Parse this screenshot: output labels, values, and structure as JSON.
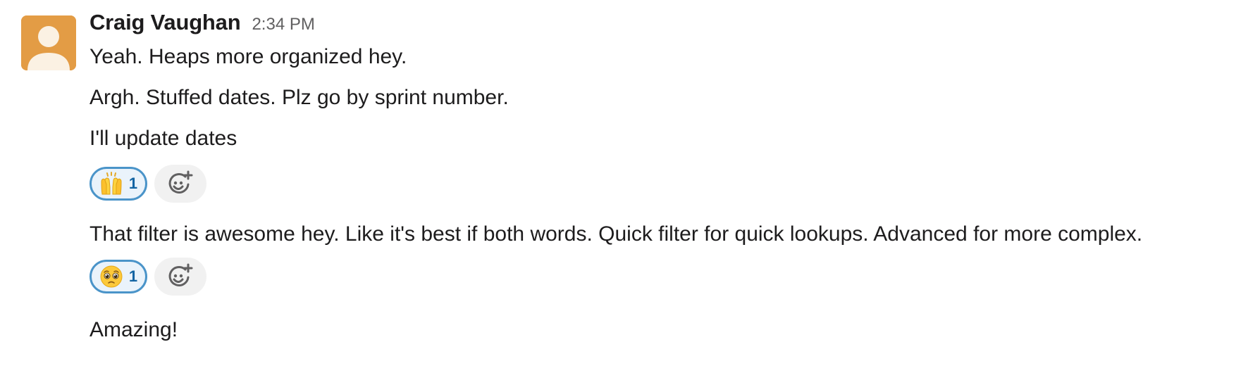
{
  "message_group": {
    "author": "Craig Vaughan",
    "timestamp": "2:34 PM",
    "avatar_color": "#e39c45",
    "messages": [
      {
        "text": "Yeah. Heaps more organized hey."
      },
      {
        "text": "Argh. Stuffed dates. Plz go by sprint number."
      },
      {
        "text": "I'll update dates",
        "reactions": [
          {
            "emoji": "raising-hands-emoji",
            "count": "1"
          }
        ]
      },
      {
        "text": "That filter is awesome hey. Like it's best if both words. Quick filter for quick lookups. Advanced for more complex.",
        "reactions": [
          {
            "emoji": "pleading-face-emoji",
            "count": "1"
          }
        ]
      },
      {
        "text": "Amazing!"
      }
    ]
  },
  "colors": {
    "reaction_border": "#4a94c9",
    "reaction_background": "#eaf3fb",
    "reaction_count": "#1264a3",
    "add_reaction_background": "#f1f1f1"
  }
}
